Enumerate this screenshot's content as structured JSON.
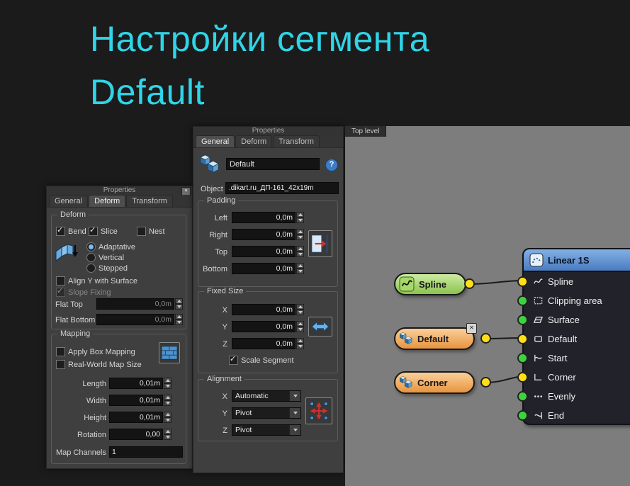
{
  "title": {
    "line1": "Настройки сегмента",
    "line2": "Default"
  },
  "left_panel": {
    "header": "Properties",
    "tabs": [
      {
        "label": "General",
        "active": "false"
      },
      {
        "label": "Deform",
        "active": "true"
      },
      {
        "label": "Transform",
        "active": "false"
      }
    ],
    "deform": {
      "label": "Deform",
      "bend": {
        "label": "Bend",
        "checked": "true"
      },
      "slice": {
        "label": "Slice",
        "checked": "true"
      },
      "nest": {
        "label": "Nest",
        "checked": "false"
      },
      "adaptative": {
        "label": "Adaptative",
        "selected": "true"
      },
      "vertical": {
        "label": "Vertical",
        "selected": "false"
      },
      "stepped": {
        "label": "Stepped",
        "selected": "false"
      },
      "align_y": {
        "label": "Align Y with Surface",
        "checked": "false"
      },
      "slope_fixing": {
        "label": "Slope Fixing",
        "checked": "true"
      },
      "flat_top": {
        "label": "Flat Top",
        "value": "0,0m"
      },
      "flat_bottom": {
        "label": "Flat Bottom",
        "value": "0,0m"
      }
    },
    "mapping": {
      "label": "Mapping",
      "apply_box": {
        "label": "Apply Box Mapping",
        "checked": "false"
      },
      "real_world": {
        "label": "Real-World Map Size",
        "checked": "false"
      },
      "length": {
        "label": "Length",
        "value": "0,01m"
      },
      "width": {
        "label": "Width",
        "value": "0,01m"
      },
      "height": {
        "label": "Height",
        "value": "0,01m"
      },
      "rotation": {
        "label": "Rotation",
        "value": "0,00"
      },
      "map_channels": {
        "label": "Map Channels",
        "value": "1"
      }
    }
  },
  "middle_panel": {
    "header": "Properties",
    "tabs": [
      {
        "label": "General",
        "active": "true"
      },
      {
        "label": "Deform",
        "active": "false"
      },
      {
        "label": "Transform",
        "active": "false"
      }
    ],
    "name_value": "Default",
    "help_glyph": "?",
    "object_label": "Object",
    "object_value": ".dikart.ru_ДП-161_42x19m",
    "padding": {
      "label": "Padding",
      "rows": [
        {
          "label": "Left",
          "value": "0,0m"
        },
        {
          "label": "Right",
          "value": "0,0m"
        },
        {
          "label": "Top",
          "value": "0,0m"
        },
        {
          "label": "Bottom",
          "value": "0,0m"
        }
      ]
    },
    "fixed_size": {
      "label": "Fixed Size",
      "rows": [
        {
          "label": "X",
          "value": "0,0m"
        },
        {
          "label": "Y",
          "value": "0,0m"
        },
        {
          "label": "Z",
          "value": "0,0m"
        }
      ],
      "scale_segment": {
        "label": "Scale Segment",
        "checked": "true"
      }
    },
    "alignment": {
      "label": "Alignment",
      "rows": [
        {
          "label": "X",
          "value": "Automatic"
        },
        {
          "label": "Y",
          "value": "Pivot"
        },
        {
          "label": "Z",
          "value": "Pivot"
        }
      ]
    }
  },
  "node_editor": {
    "tab": "Top level",
    "spline_node": {
      "label": "Spline"
    },
    "default_node": {
      "label": "Default",
      "close_glyph": "✕"
    },
    "corner_node": {
      "label": "Corner"
    },
    "linear_node": {
      "label": "Linear 1S",
      "inputs": [
        {
          "label": "Spline",
          "dot": "yellow"
        },
        {
          "label": "Clipping area",
          "dot": "green"
        },
        {
          "label": "Surface",
          "dot": "green"
        },
        {
          "label": "Default",
          "dot": "yellow"
        },
        {
          "label": "Start",
          "dot": "green"
        },
        {
          "label": "Corner",
          "dot": "yellow"
        },
        {
          "label": "Evenly",
          "dot": "green"
        },
        {
          "label": "End",
          "dot": "green"
        }
      ]
    }
  },
  "colors": {
    "accent_cyan": "#2fd5e8",
    "node_green": "#9cd05a",
    "node_orange": "#f0a55c",
    "linear_header_blue": "#5b93d8",
    "dot_yellow": "#ffdf1a",
    "dot_green": "#3cd43c"
  }
}
